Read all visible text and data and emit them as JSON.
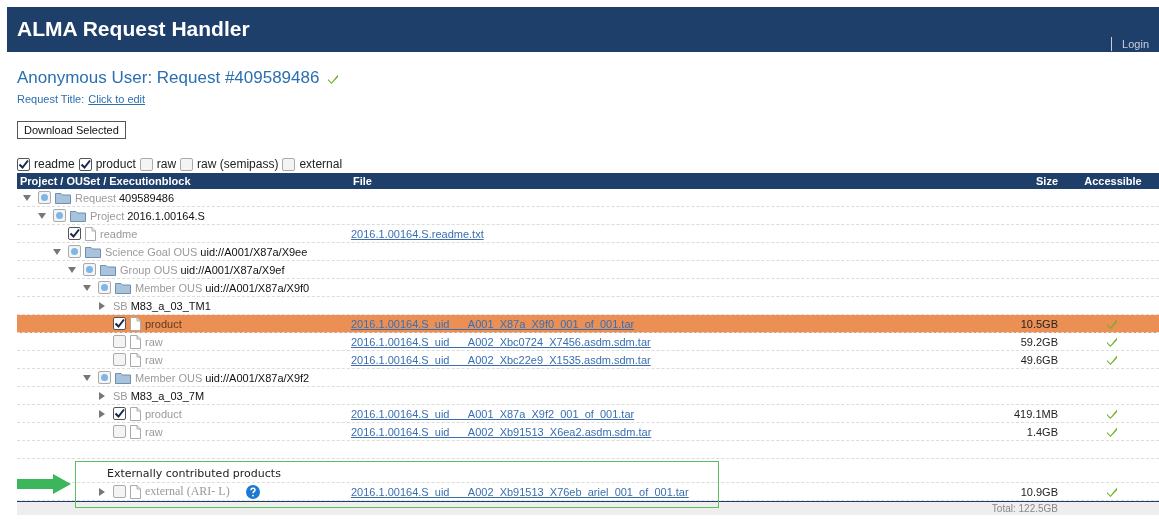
{
  "header": {
    "title": "ALMA Request Handler",
    "login": "Login"
  },
  "request": {
    "heading": "Anonymous User: Request #409589486",
    "verified": true,
    "title_label": "Request Title:",
    "title_link": "Click to edit"
  },
  "download_button": "Download Selected",
  "filters": [
    {
      "label": "readme",
      "checked": true
    },
    {
      "label": "product",
      "checked": true
    },
    {
      "label": "raw",
      "checked": false
    },
    {
      "label": "raw (semipass)",
      "checked": false
    },
    {
      "label": "external",
      "checked": false
    }
  ],
  "table": {
    "columns": [
      "Project / OUSet / Executionblock",
      "File",
      "Size",
      "Accessible"
    ],
    "rows": [
      {
        "kind": "folder",
        "label": "Request",
        "value": "409589486",
        "partial": true,
        "expanded": true,
        "children": [
          {
            "kind": "folder",
            "label": "Project",
            "value": "2016.1.00164.S",
            "partial": true,
            "expanded": true,
            "children": [
              {
                "kind": "file",
                "label": "readme",
                "checked": true,
                "selected": false,
                "file": "2016.1.00164.S.readme.txt"
              },
              {
                "kind": "folder",
                "label": "Science Goal OUS",
                "value": "uid://A001/X87a/X9ee",
                "partial": true,
                "expanded": true,
                "children": [
                  {
                    "kind": "folder",
                    "label": "Group OUS",
                    "value": "uid://A001/X87a/X9ef",
                    "partial": true,
                    "expanded": true,
                    "children": [
                      {
                        "kind": "folder",
                        "label": "Member OUS",
                        "value": "uid://A001/X87a/X9f0",
                        "partial": true,
                        "expanded": true,
                        "children": [
                          {
                            "kind": "sb",
                            "label": "SB",
                            "value": "M83_a_03_TM1",
                            "expanded": false
                          },
                          {
                            "kind": "file",
                            "label": "product",
                            "checked": true,
                            "selected": true,
                            "file": "2016.1.00164.S_uid___A001_X87a_X9f0_001_of_001.tar",
                            "size": "10.5GB",
                            "accessible": true
                          },
                          {
                            "kind": "file",
                            "label": "raw",
                            "checked": false,
                            "selected": false,
                            "file": "2016.1.00164.S_uid___A002_Xbc0724_X7456.asdm.sdm.tar",
                            "size": "59.2GB",
                            "accessible": true
                          },
                          {
                            "kind": "file",
                            "label": "raw",
                            "checked": false,
                            "selected": false,
                            "file": "2016.1.00164.S_uid___A002_Xbc22e9_X1535.asdm.sdm.tar",
                            "size": "49.6GB",
                            "accessible": true
                          }
                        ]
                      },
                      {
                        "kind": "folder",
                        "label": "Member OUS",
                        "value": "uid://A001/X87a/X9f2",
                        "partial": true,
                        "expanded": true,
                        "children": [
                          {
                            "kind": "sb",
                            "label": "SB",
                            "value": "M83_a_03_7M",
                            "expanded": false
                          },
                          {
                            "kind": "file",
                            "label": "product",
                            "checked": true,
                            "selected": false,
                            "expanded": false,
                            "file": "2016.1.00164.S_uid___A001_X87a_X9f2_001_of_001.tar",
                            "size": "419.1MB",
                            "accessible": true
                          },
                          {
                            "kind": "file",
                            "label": "raw",
                            "checked": false,
                            "selected": false,
                            "file": "2016.1.00164.S_uid___A002_Xb91513_X6ea2.asdm.sdm.tar",
                            "size": "1.4GB",
                            "accessible": true
                          }
                        ]
                      }
                    ]
                  }
                ]
              }
            ]
          }
        ]
      }
    ],
    "external": {
      "heading": "Externally contributed products",
      "rows": [
        {
          "kind": "external",
          "label": "external (ARI- L)",
          "help": true,
          "checked": false,
          "selected": false,
          "expanded": false,
          "file": "2016.1.00164.S_uid___A002_Xb91513_X76eb_ariel_001_of_001.tar",
          "size": "10.9GB",
          "accessible": true
        }
      ]
    },
    "total": "Total: 122.5GB"
  }
}
